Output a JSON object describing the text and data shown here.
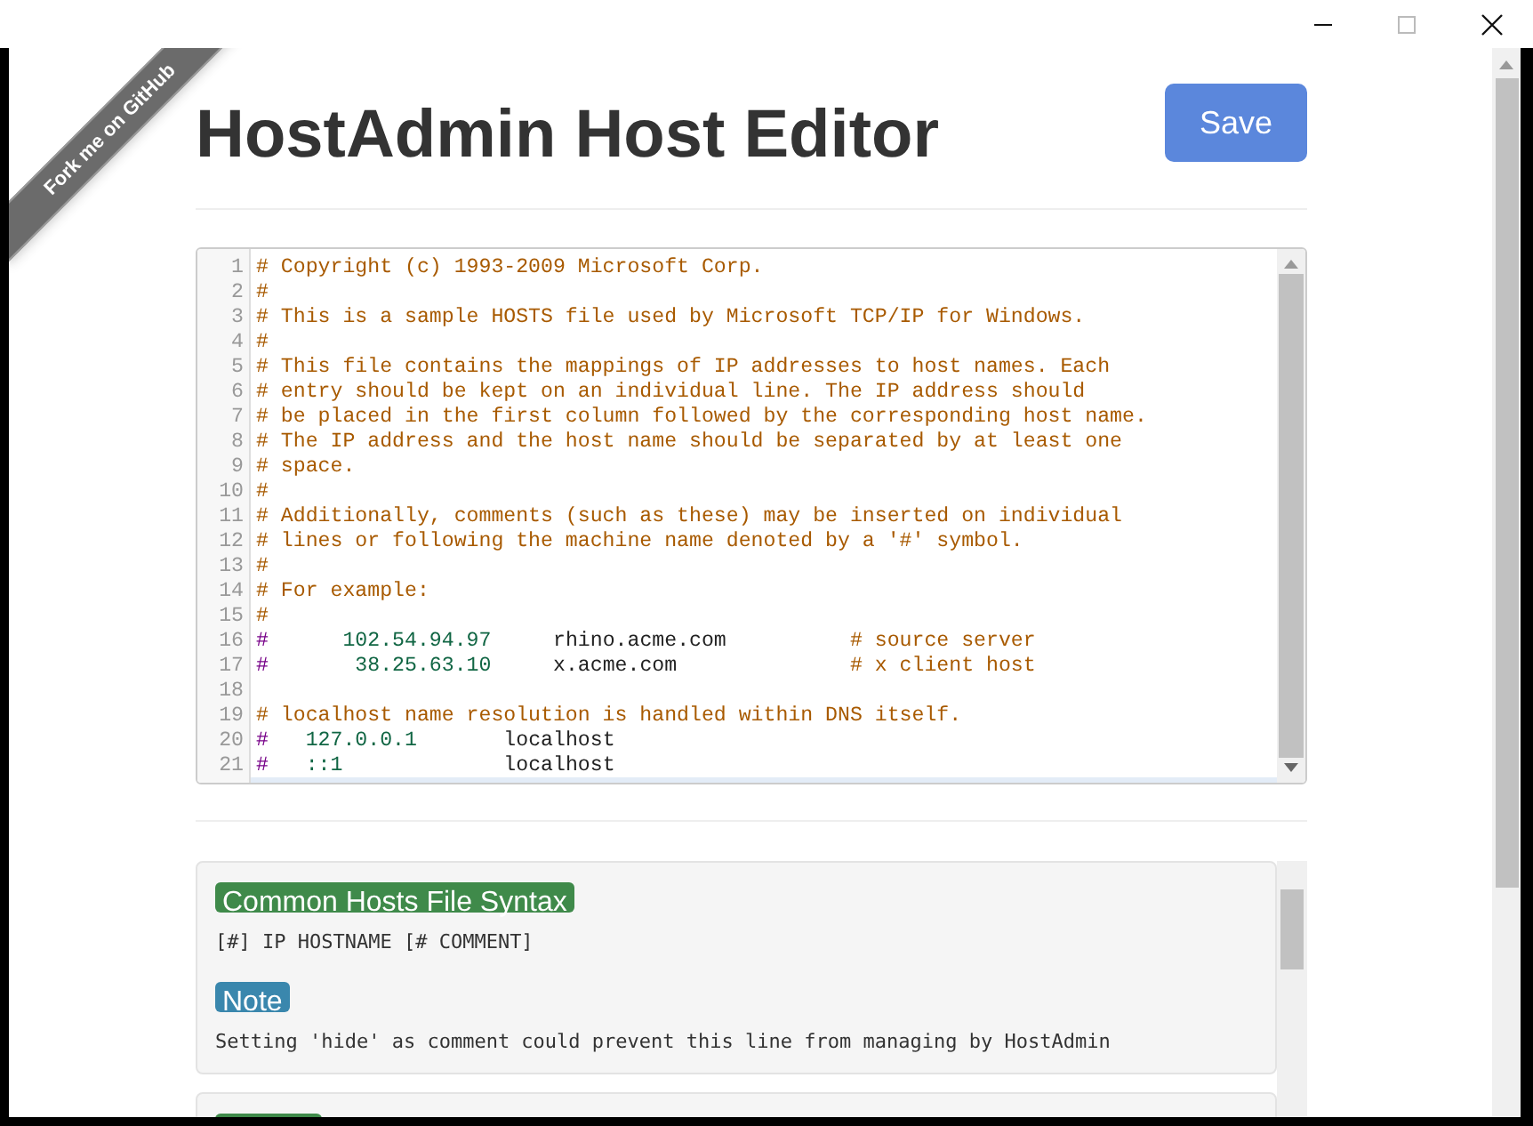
{
  "ribbon": {
    "text": "Fork me on GitHub"
  },
  "header": {
    "title": "HostAdmin Host Editor",
    "save_button": "Save"
  },
  "editor": {
    "lines": [
      {
        "number": "1",
        "tokens": [
          {
            "kind": "comment",
            "text": "# Copyright (c) 1993-2009 Microsoft Corp."
          }
        ]
      },
      {
        "number": "2",
        "tokens": [
          {
            "kind": "comment",
            "text": "#"
          }
        ]
      },
      {
        "number": "3",
        "tokens": [
          {
            "kind": "comment",
            "text": "# This is a sample HOSTS file used by Microsoft TCP/IP for Windows."
          }
        ]
      },
      {
        "number": "4",
        "tokens": [
          {
            "kind": "comment",
            "text": "#"
          }
        ]
      },
      {
        "number": "5",
        "tokens": [
          {
            "kind": "comment",
            "text": "# This file contains the mappings of IP addresses to host names. Each"
          }
        ]
      },
      {
        "number": "6",
        "tokens": [
          {
            "kind": "comment",
            "text": "# entry should be kept on an individual line. The IP address should"
          }
        ]
      },
      {
        "number": "7",
        "tokens": [
          {
            "kind": "comment",
            "text": "# be placed in the first column followed by the corresponding host name."
          }
        ]
      },
      {
        "number": "8",
        "tokens": [
          {
            "kind": "comment",
            "text": "# The IP address and the host name should be separated by at least one"
          }
        ]
      },
      {
        "number": "9",
        "tokens": [
          {
            "kind": "comment",
            "text": "# space."
          }
        ]
      },
      {
        "number": "10",
        "tokens": [
          {
            "kind": "comment",
            "text": "#"
          }
        ]
      },
      {
        "number": "11",
        "tokens": [
          {
            "kind": "comment",
            "text": "# Additionally, comments (such as these) may be inserted on individual"
          }
        ]
      },
      {
        "number": "12",
        "tokens": [
          {
            "kind": "comment",
            "text": "# lines or following the machine name denoted by a '#' symbol."
          }
        ]
      },
      {
        "number": "13",
        "tokens": [
          {
            "kind": "comment",
            "text": "#"
          }
        ]
      },
      {
        "number": "14",
        "tokens": [
          {
            "kind": "comment",
            "text": "# For example:"
          }
        ]
      },
      {
        "number": "15",
        "tokens": [
          {
            "kind": "comment",
            "text": "#"
          }
        ]
      },
      {
        "number": "16",
        "tokens": [
          {
            "kind": "hash",
            "text": "#"
          },
          {
            "kind": "ip",
            "text": "      102.54.94.97"
          },
          {
            "kind": "host",
            "text": "     rhino.acme.com"
          },
          {
            "kind": "comment",
            "text": "          # source server"
          }
        ]
      },
      {
        "number": "17",
        "tokens": [
          {
            "kind": "hash",
            "text": "#"
          },
          {
            "kind": "ip",
            "text": "       38.25.63.10"
          },
          {
            "kind": "host",
            "text": "     x.acme.com"
          },
          {
            "kind": "comment",
            "text": "              # x client host"
          }
        ]
      },
      {
        "number": "18"
      },
      {
        "number": "19",
        "tokens": [
          {
            "kind": "comment",
            "text": "# localhost name resolution is handled within DNS itself."
          }
        ]
      },
      {
        "number": "20",
        "tokens": [
          {
            "kind": "hash",
            "text": "#"
          },
          {
            "kind": "ip",
            "text": "   127.0.0.1"
          },
          {
            "kind": "host",
            "text": "       localhost"
          }
        ]
      },
      {
        "number": "21",
        "tokens": [
          {
            "kind": "hash",
            "text": "#"
          },
          {
            "kind": "ip",
            "text": "   ::1"
          },
          {
            "kind": "host",
            "text": "             localhost"
          }
        ]
      }
    ]
  },
  "panels": [
    {
      "items": [
        {
          "badge": "Common Hosts File Syntax",
          "color": "#3f8a4a",
          "body": "[#] IP HOSTNAME [# COMMENT]"
        },
        {
          "badge": "Note",
          "color": "#3a87ad",
          "body": "Setting 'hide' as comment could prevent this line from managing by HostAdmin"
        }
      ]
    },
    {
      "items": [
        {
          "color": "#3f8a4a"
        }
      ]
    }
  ]
}
